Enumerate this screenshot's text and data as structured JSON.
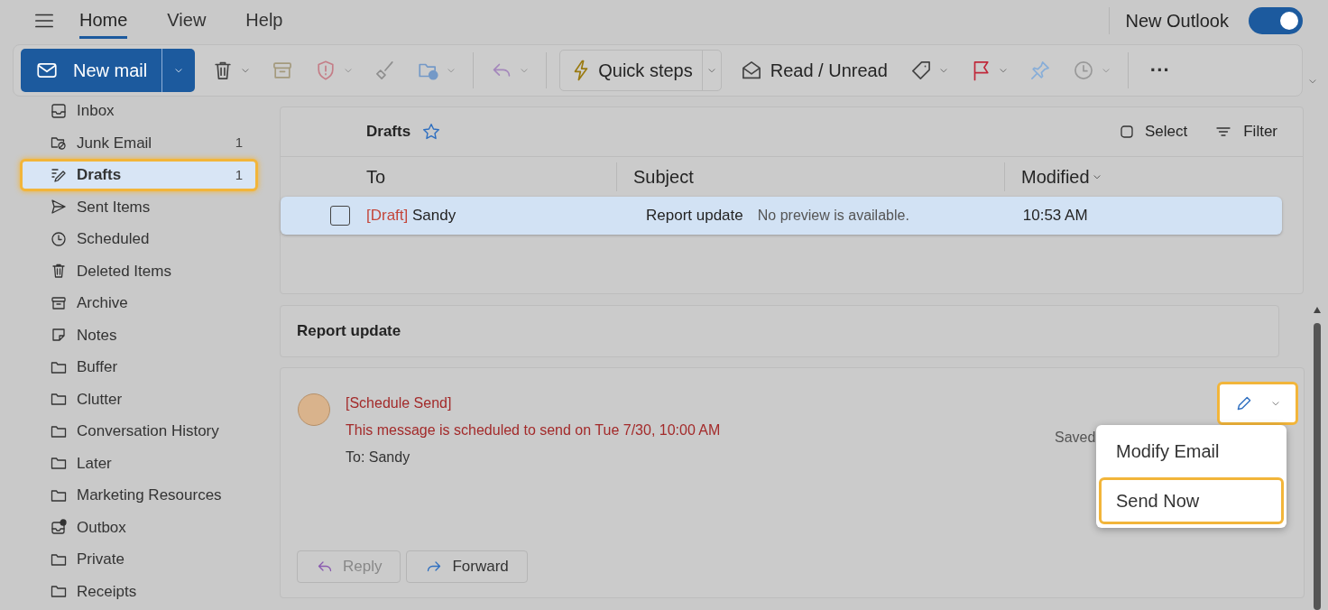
{
  "menu_tabs": [
    {
      "label": "Home",
      "selected": true
    },
    {
      "label": "View",
      "selected": false
    },
    {
      "label": "Help",
      "selected": false
    }
  ],
  "new_outlook": {
    "label": "New Outlook",
    "on": true
  },
  "toolbar": {
    "new_mail": "New mail",
    "items": [
      {
        "kind": "delete",
        "has_menu": true,
        "disabled": false
      },
      {
        "kind": "archive",
        "has_menu": false,
        "disabled": true
      },
      {
        "kind": "report",
        "has_menu": true,
        "disabled": true
      },
      {
        "kind": "sweep",
        "has_menu": false,
        "disabled": true
      },
      {
        "kind": "move",
        "has_menu": true,
        "disabled": true
      },
      {
        "kind": "separator"
      },
      {
        "kind": "reply",
        "has_menu": true,
        "disabled": true
      },
      {
        "kind": "separator"
      },
      {
        "kind": "quick_steps",
        "label": "Quick steps",
        "has_menu": true,
        "disabled": false
      },
      {
        "kind": "read_unread",
        "label": "Read / Unread",
        "disabled": false
      },
      {
        "kind": "tag",
        "has_menu": true,
        "disabled": false
      },
      {
        "kind": "flag",
        "has_menu": true,
        "disabled": false
      },
      {
        "kind": "pin",
        "has_menu": false,
        "disabled": true
      },
      {
        "kind": "snooze",
        "has_menu": true,
        "disabled": true
      },
      {
        "kind": "separator"
      },
      {
        "kind": "more",
        "label": "···",
        "disabled": false
      }
    ]
  },
  "folders": [
    {
      "kind": "inbox",
      "label": "Inbox",
      "selected": false,
      "highlighted": false
    },
    {
      "kind": "junk",
      "label": "Junk Email",
      "count": "1",
      "selected": false,
      "highlighted": false
    },
    {
      "kind": "drafts",
      "label": "Drafts",
      "count": "1",
      "selected": true,
      "highlighted": true
    },
    {
      "kind": "sent",
      "label": "Sent Items",
      "selected": false,
      "highlighted": false
    },
    {
      "kind": "scheduled",
      "label": "Scheduled",
      "selected": false,
      "highlighted": false
    },
    {
      "kind": "deleted",
      "label": "Deleted Items",
      "selected": false,
      "highlighted": false
    },
    {
      "kind": "archive",
      "label": "Archive",
      "selected": false,
      "highlighted": false
    },
    {
      "kind": "notes",
      "label": "Notes",
      "selected": false,
      "highlighted": false
    },
    {
      "kind": "folder",
      "label": "Buffer",
      "selected": false,
      "highlighted": false
    },
    {
      "kind": "folder",
      "label": "Clutter",
      "selected": false,
      "highlighted": false
    },
    {
      "kind": "folder",
      "label": "Conversation History",
      "selected": false,
      "highlighted": false
    },
    {
      "kind": "folder",
      "label": "Later",
      "selected": false,
      "highlighted": false
    },
    {
      "kind": "folder",
      "label": "Marketing Resources",
      "selected": false,
      "highlighted": false
    },
    {
      "kind": "outbox",
      "label": "Outbox",
      "selected": false,
      "highlighted": false
    },
    {
      "kind": "folder",
      "label": "Private",
      "selected": false,
      "highlighted": false
    },
    {
      "kind": "folder",
      "label": "Receipts",
      "selected": false,
      "highlighted": false
    }
  ],
  "message_list": {
    "title": "Drafts",
    "favorite": false,
    "select": "Select",
    "filter": "Filter",
    "columns": [
      "To",
      "Subject",
      "Modified"
    ],
    "rows": [
      {
        "tag": "[Draft]",
        "to": "Sandy",
        "subject": "Report update",
        "preview": "No preview is available.",
        "modified": "10:53 AM",
        "selected": true,
        "checked": false
      }
    ]
  },
  "reading_pane": {
    "subject": "Report update",
    "message": {
      "tag": "[Schedule Send]",
      "notice": "This message is scheduled to send on Tue 7/30, 10:00 AM",
      "to": "To: Sandy",
      "saved": "Saved",
      "edit_highlighted": true
    },
    "actions": [
      {
        "kind": "reply",
        "label": "Reply",
        "disabled": true
      },
      {
        "kind": "forward",
        "label": "Forward",
        "disabled": false
      }
    ],
    "menu": [
      {
        "label": "Modify Email",
        "highlighted": false
      },
      {
        "label": "Send Now",
        "highlighted": true
      }
    ]
  }
}
